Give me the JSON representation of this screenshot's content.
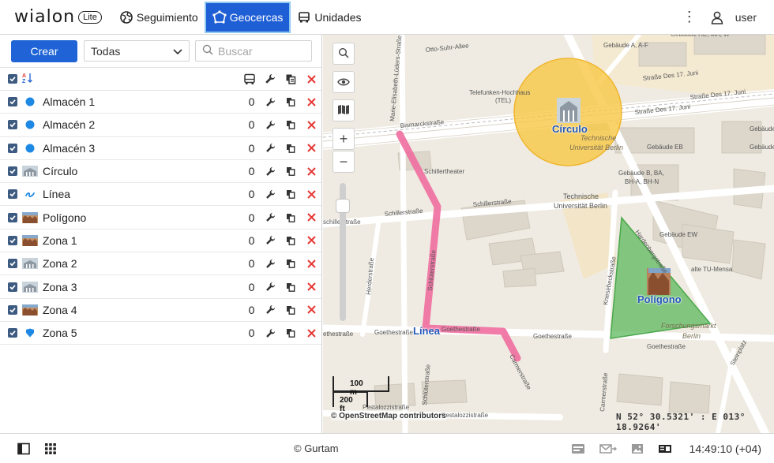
{
  "app": {
    "logo_text": "wialon",
    "logo_badge": "Lite"
  },
  "nav": {
    "tabs": [
      {
        "label": "Seguimiento",
        "icon": "globe-icon"
      },
      {
        "label": "Geocercas",
        "icon": "geofence-icon",
        "active": true
      },
      {
        "label": "Unidades",
        "icon": "bus-icon"
      }
    ],
    "user_label": "user"
  },
  "toolbar": {
    "create_label": "Crear",
    "filter_value": "Todas",
    "search_placeholder": "Buscar"
  },
  "geofences": [
    {
      "name": "Almacén 1",
      "count": "0",
      "icon": "circle-dot-icon"
    },
    {
      "name": "Almacén 2",
      "count": "0",
      "icon": "circle-dot-icon"
    },
    {
      "name": "Almacén 3",
      "count": "0",
      "icon": "circle-dot-icon"
    },
    {
      "name": "Círculo",
      "count": "0",
      "icon": "building-thumb-icon"
    },
    {
      "name": "Línea",
      "count": "0",
      "icon": "line-squiggle-icon"
    },
    {
      "name": "Polígono",
      "count": "0",
      "icon": "city-thumb-icon"
    },
    {
      "name": "Zona 1",
      "count": "0",
      "icon": "city-thumb-icon"
    },
    {
      "name": "Zona 2",
      "count": "0",
      "icon": "building-thumb-icon"
    },
    {
      "name": "Zona 3",
      "count": "0",
      "icon": "building-thumb-icon"
    },
    {
      "name": "Zona 4",
      "count": "0",
      "icon": "city-thumb-icon"
    },
    {
      "name": "Zona 5",
      "count": "0",
      "icon": "shield-pin-icon"
    }
  ],
  "map": {
    "labels": {
      "circle": "Círculo",
      "line": "Línea",
      "polygon": "Polígono"
    },
    "streets": [
      "Otto-Suhr-Allee",
      "Bismarckstraße",
      "Schillertheater",
      "Schillerstraße",
      "Technische Universität Berlin",
      "Telefunken-Hochhaus (TEL)",
      "Straße Des 17. Juni",
      "Hardenbergstraße",
      "Goethestraße",
      "Pestalozzistraße",
      "Schlüterstraße",
      "Herderstraße",
      "Knesebeckstraße",
      "Carmerstraße",
      "Steinplatz",
      "Forschungsmarkt Berlin",
      "Marie-Elisabeth-Lüders-Straße",
      "Gebäude HE, MA, W",
      "Gebäude A, A-F",
      "Gebäude EB",
      "Gebäude B, BA, BH-A, BH-N",
      "Gebäude EW",
      "alte TU-Mensa",
      "Gebäude EN",
      "Gebäude E"
    ],
    "scale_top": "100 m",
    "scale_bottom": "200 ft",
    "attribution": "© OpenStreetMap contributors",
    "coordinates": "N 52° 30.5321' : E 013° 18.9264'"
  },
  "footer": {
    "copyright": "© Gurtam",
    "clock": "14:49:10 (+04)"
  },
  "colors": {
    "accent": "#1f5fd6",
    "circle_fill": "#f7c845",
    "polygon_fill": "#5cb85c",
    "line_stroke": "#f06ea0",
    "delete_red": "#e53935"
  }
}
